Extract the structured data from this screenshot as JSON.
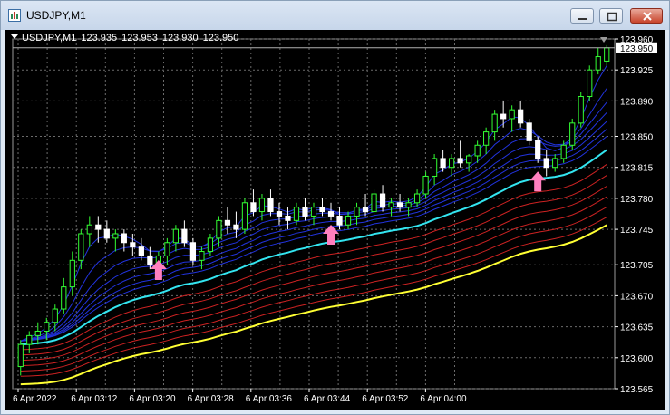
{
  "window": {
    "title": "USDJPY,M1",
    "icon": "chart-window-icon",
    "buttons": [
      "minimize-icon",
      "maximize-icon",
      "close-icon"
    ]
  },
  "chart_header": {
    "symbol": "USDJPY,M1",
    "open": "123.935",
    "high": "123.953",
    "low": "123.930",
    "close": "123.950"
  },
  "colors": {
    "background": "#000000",
    "grid": "#6b6b6b",
    "bull": "#33ff33",
    "bear": "#ffffff",
    "ma_blue": "#2233dd",
    "ma_cyan": "#33e5f0",
    "ma_red": "#cc2222",
    "ma_yellow": "#ffff33",
    "arrow": "#ff7fbf",
    "price_line": "#b0b0b0"
  },
  "chart_data": {
    "type": "candlestick",
    "y_ticks": [
      "123.960",
      "123.925",
      "123.890",
      "123.850",
      "123.815",
      "123.780",
      "123.745",
      "123.705",
      "123.670",
      "123.635",
      "123.600",
      "123.565"
    ],
    "ylim": [
      123.565,
      123.96
    ],
    "current_price": "123.950",
    "x_ticks": [
      "6 Apr 2022",
      "6 Apr 03:12",
      "6 Apr 03:20",
      "6 Apr 03:28",
      "6 Apr 03:36",
      "6 Apr 03:44",
      "6 Apr 03:52",
      "6 Apr 04:00"
    ],
    "candles": [
      [
        123.59,
        123.62,
        123.58,
        123.615
      ],
      [
        123.615,
        123.63,
        123.605,
        123.625
      ],
      [
        123.625,
        123.64,
        123.615,
        123.63
      ],
      [
        123.63,
        123.645,
        123.62,
        123.64
      ],
      [
        123.64,
        123.66,
        123.63,
        123.655
      ],
      [
        123.655,
        123.69,
        123.65,
        123.68
      ],
      [
        123.68,
        123.72,
        123.67,
        123.71
      ],
      [
        123.71,
        123.745,
        123.7,
        123.74
      ],
      [
        123.74,
        123.76,
        123.725,
        123.75
      ],
      [
        123.75,
        123.76,
        123.73,
        123.745
      ],
      [
        123.745,
        123.755,
        123.73,
        123.735
      ],
      [
        123.735,
        123.745,
        123.72,
        123.74
      ],
      [
        123.74,
        123.745,
        123.72,
        123.73
      ],
      [
        123.73,
        123.74,
        123.715,
        123.725
      ],
      [
        123.725,
        123.735,
        123.71,
        123.715
      ],
      [
        123.715,
        123.725,
        123.7,
        123.705
      ],
      [
        123.705,
        123.72,
        123.7,
        123.715
      ],
      [
        123.715,
        123.735,
        123.705,
        123.73
      ],
      [
        123.73,
        123.75,
        123.72,
        123.745
      ],
      [
        123.745,
        123.755,
        123.725,
        123.73
      ],
      [
        123.73,
        123.735,
        123.705,
        123.71
      ],
      [
        123.71,
        123.725,
        123.7,
        123.72
      ],
      [
        123.72,
        123.74,
        123.715,
        123.735
      ],
      [
        123.735,
        123.76,
        123.725,
        123.755
      ],
      [
        123.755,
        123.77,
        123.74,
        123.75
      ],
      [
        123.75,
        123.765,
        123.735,
        123.745
      ],
      [
        123.745,
        123.78,
        123.74,
        123.775
      ],
      [
        123.775,
        123.79,
        123.76,
        123.765
      ],
      [
        123.765,
        123.785,
        123.755,
        123.78
      ],
      [
        123.78,
        123.79,
        123.76,
        123.765
      ],
      [
        123.765,
        123.775,
        123.75,
        123.76
      ],
      [
        123.76,
        123.77,
        123.745,
        123.755
      ],
      [
        123.755,
        123.775,
        123.75,
        123.77
      ],
      [
        123.77,
        123.78,
        123.755,
        123.76
      ],
      [
        123.76,
        123.775,
        123.75,
        123.77
      ],
      [
        123.77,
        123.78,
        123.76,
        123.765
      ],
      [
        123.765,
        123.775,
        123.755,
        123.76
      ],
      [
        123.76,
        123.77,
        123.745,
        123.75
      ],
      [
        123.75,
        123.765,
        123.745,
        123.76
      ],
      [
        123.76,
        123.775,
        123.75,
        123.77
      ],
      [
        123.77,
        123.785,
        123.76,
        123.765
      ],
      [
        123.765,
        123.79,
        123.76,
        123.785
      ],
      [
        123.785,
        123.795,
        123.765,
        123.77
      ],
      [
        123.77,
        123.78,
        123.76,
        123.775
      ],
      [
        123.775,
        123.785,
        123.765,
        123.77
      ],
      [
        123.77,
        123.78,
        123.76,
        123.775
      ],
      [
        123.775,
        123.79,
        123.77,
        123.785
      ],
      [
        123.785,
        123.81,
        123.78,
        123.805
      ],
      [
        123.805,
        123.83,
        123.795,
        123.825
      ],
      [
        123.825,
        123.835,
        123.81,
        123.815
      ],
      [
        123.815,
        123.83,
        123.805,
        123.825
      ],
      [
        123.825,
        123.845,
        123.815,
        123.82
      ],
      [
        123.82,
        123.83,
        123.81,
        123.828
      ],
      [
        123.828,
        123.845,
        123.82,
        123.84
      ],
      [
        123.84,
        123.86,
        123.83,
        123.855
      ],
      [
        123.855,
        123.88,
        123.845,
        123.875
      ],
      [
        123.875,
        123.89,
        123.86,
        123.87
      ],
      [
        123.87,
        123.885,
        123.855,
        123.88
      ],
      [
        123.88,
        123.89,
        123.86,
        123.865
      ],
      [
        123.865,
        123.87,
        123.84,
        123.845
      ],
      [
        123.845,
        123.85,
        123.82,
        123.825
      ],
      [
        123.825,
        123.835,
        123.805,
        123.815
      ],
      [
        123.815,
        123.83,
        123.81,
        123.825
      ],
      [
        123.825,
        123.845,
        123.82,
        123.84
      ],
      [
        123.84,
        123.87,
        123.835,
        123.865
      ],
      [
        123.865,
        123.9,
        123.86,
        123.895
      ],
      [
        123.895,
        123.93,
        123.89,
        123.925
      ],
      [
        123.925,
        123.95,
        123.92,
        123.94
      ],
      [
        123.935,
        123.953,
        123.93,
        123.95
      ]
    ],
    "ma_bands": {
      "blue": 7,
      "red": 6
    },
    "signals": [
      {
        "candle": 16,
        "price": 123.698
      },
      {
        "candle": 36,
        "price": 123.738
      },
      {
        "candle": 60,
        "price": 123.798
      }
    ]
  }
}
